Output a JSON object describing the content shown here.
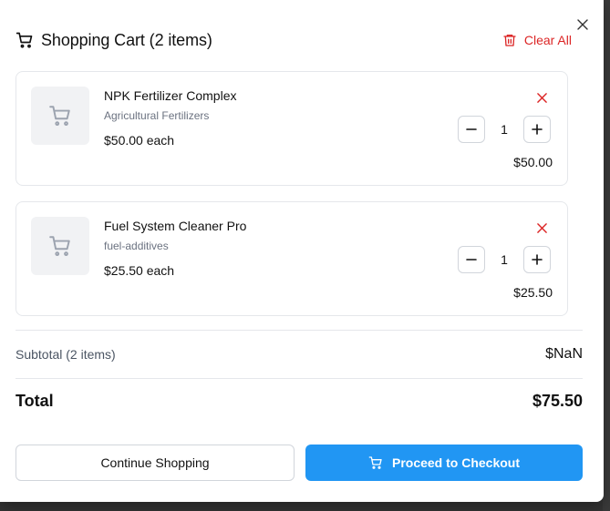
{
  "cart": {
    "title": "Shopping Cart (2 items)",
    "clear_all_label": "Clear All",
    "items": [
      {
        "name": "NPK Fertilizer Complex",
        "category": "Agricultural Fertilizers",
        "unit_price": "$50.00 each",
        "quantity": "1",
        "line_total": "$50.00"
      },
      {
        "name": "Fuel System Cleaner Pro",
        "category": "fuel-additives",
        "unit_price": "$25.50 each",
        "quantity": "1",
        "line_total": "$25.50"
      }
    ],
    "subtotal_label": "Subtotal (2 items)",
    "subtotal_value": "$NaN",
    "total_label": "Total",
    "total_value": "$75.50",
    "continue_label": "Continue Shopping",
    "checkout_label": "Proceed to Checkout"
  },
  "icons": {
    "close": "close-icon",
    "cart": "cart-icon",
    "trash": "trash-icon",
    "remove": "x-icon",
    "minus": "minus-icon",
    "plus": "plus-icon"
  },
  "colors": {
    "accent": "#2196f3",
    "danger": "#dc2626",
    "muted": "#6b7280"
  }
}
